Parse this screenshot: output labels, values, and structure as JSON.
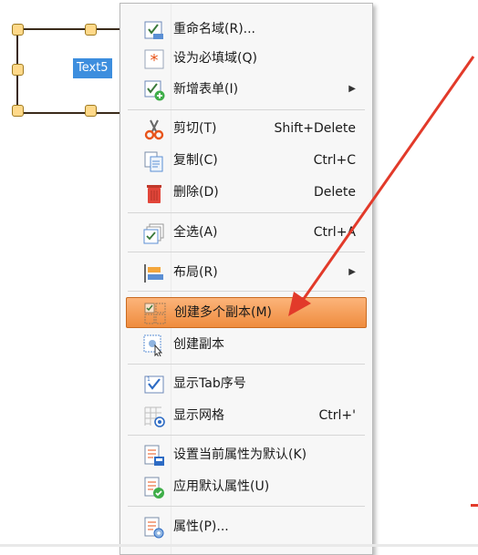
{
  "canvas": {
    "field_label": "Text5"
  },
  "context_menu": {
    "items": [
      {
        "label": "重命名域(R)...",
        "shortcut": "",
        "icon": "rename-field-icon"
      },
      {
        "label": "设为必填域(Q)",
        "shortcut": "",
        "icon": "required-asterisk-icon"
      },
      {
        "label": "新增表单(I)",
        "shortcut": "",
        "icon": "new-form-icon",
        "submenu": "▶"
      },
      {
        "label": "剪切(T)",
        "shortcut": "Shift+Delete",
        "icon": "scissors-icon"
      },
      {
        "label": "复制(C)",
        "shortcut": "Ctrl+C",
        "icon": "copy-icon"
      },
      {
        "label": "删除(D)",
        "shortcut": "Delete",
        "icon": "trash-icon"
      },
      {
        "label": "全选(A)",
        "shortcut": "Ctrl+A",
        "icon": "select-all-icon"
      },
      {
        "label": "布局(R)",
        "shortcut": "",
        "icon": "layout-icon",
        "submenu": "▶"
      },
      {
        "label": "创建多个副本(M)",
        "shortcut": "",
        "icon": "multiple-copies-icon"
      },
      {
        "label": "创建副本",
        "shortcut": "",
        "icon": "create-copy-icon"
      },
      {
        "label": "显示Tab序号",
        "shortcut": "",
        "icon": "tab-order-icon"
      },
      {
        "label": "显示网格",
        "shortcut": "Ctrl+'",
        "icon": "grid-icon"
      },
      {
        "label": "设置当前属性为默认(K)",
        "shortcut": "",
        "icon": "set-default-props-icon"
      },
      {
        "label": "应用默认属性(U)",
        "shortcut": "",
        "icon": "apply-default-props-icon"
      },
      {
        "label": "属性(P)...",
        "shortcut": "",
        "icon": "properties-icon"
      }
    ]
  },
  "colors": {
    "highlight": "#ef8c3e",
    "arrow": "#e23a2a",
    "field_tag": "#3d8ede"
  }
}
